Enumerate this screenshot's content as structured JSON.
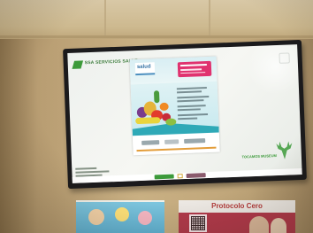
{
  "scene": {
    "description_tags": [
      "wall",
      "ceiling",
      "television",
      "poster"
    ],
    "tv": {
      "screen": {
        "header_logo": "SSA SERVICIOS SALUD",
        "poster": {
          "badge": "salud",
          "promo_colors": {
            "pink": "#e0326f",
            "teal": "#2fa9b7",
            "orange": "#e39d3a"
          }
        },
        "deer_logo_text": "TOCAMOS MUSEUM",
        "footer": {}
      }
    },
    "lower_posters": {
      "right_header": "Protocolo Cero"
    }
  },
  "colors": {
    "wall": "#c9b083",
    "ceiling": "#d8c8a6",
    "bezel": "#1b1a1c",
    "brand_green": "#3c9a3a"
  }
}
